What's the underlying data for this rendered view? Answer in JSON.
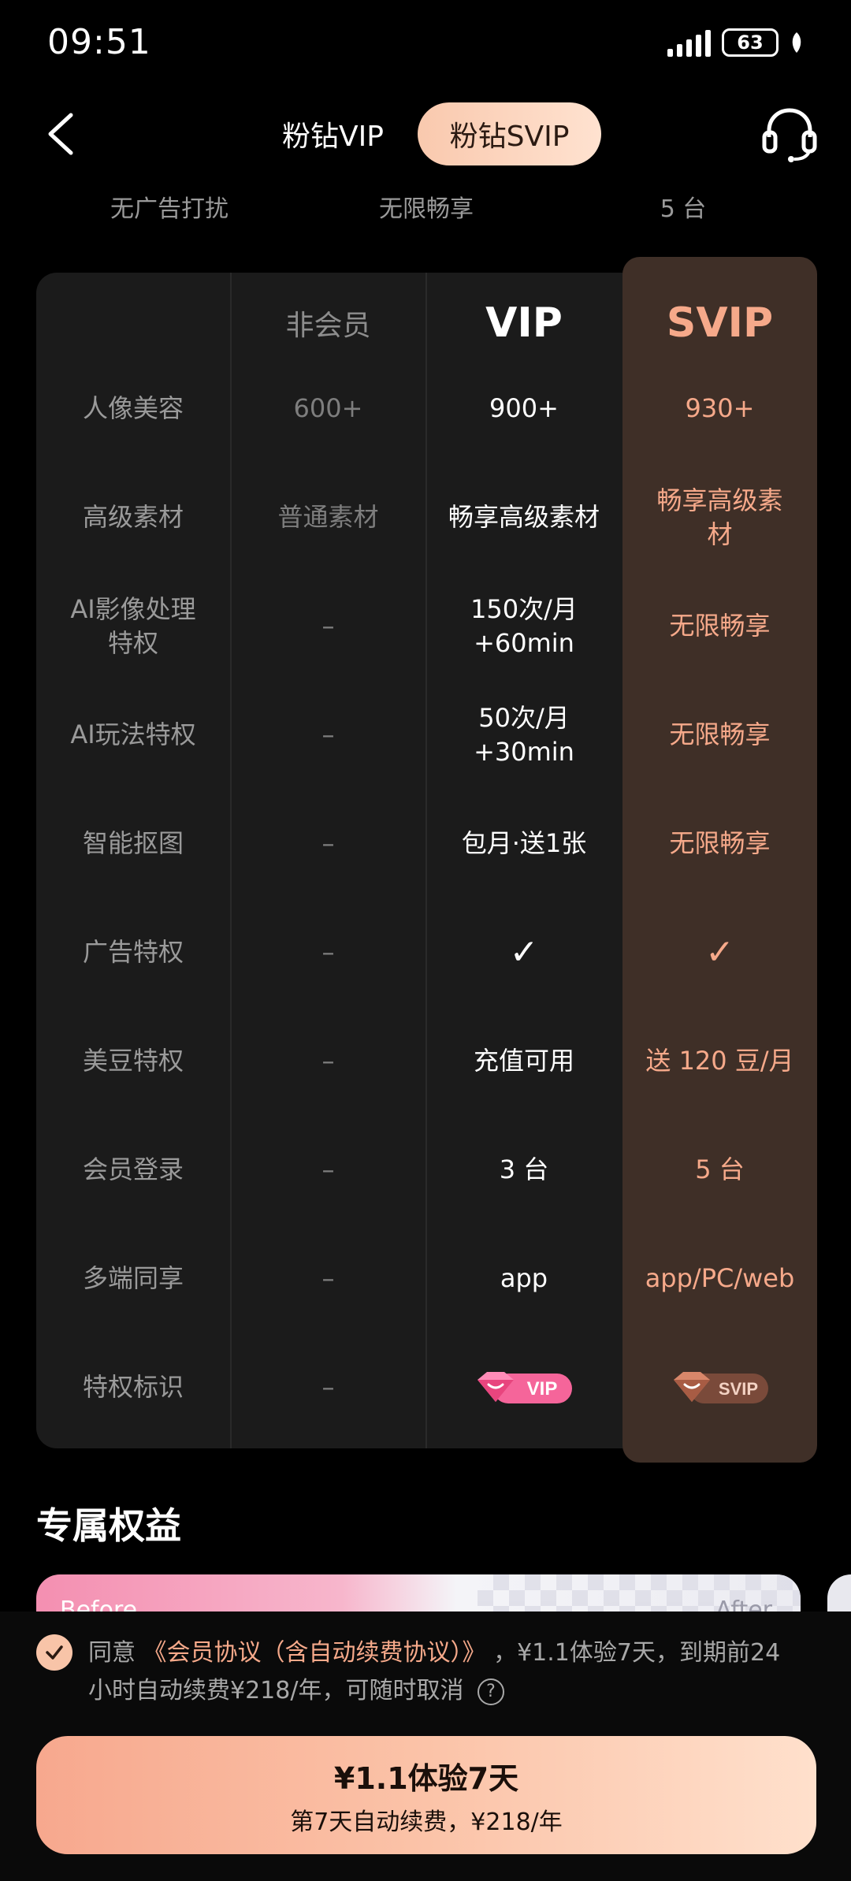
{
  "status_bar": {
    "time": "09:51",
    "battery": "63"
  },
  "header": {
    "tabs": [
      {
        "label": "粉钻VIP"
      },
      {
        "label": "粉钻SVIP"
      }
    ]
  },
  "summary": [
    "无广告打扰",
    "无限畅享",
    "5 台"
  ],
  "table": {
    "headers": {
      "non_member": "非会员",
      "vip": "VIP",
      "svip": "SVIP"
    },
    "rows": [
      {
        "label": "人像美容",
        "non_member": "600+",
        "vip": "900+",
        "svip": "930+"
      },
      {
        "label": "高级素材",
        "non_member": "普通素材",
        "vip": "畅享高级素材",
        "svip": "畅享高级素材"
      },
      {
        "label": "AI影像处理特权",
        "non_member": "–",
        "vip": "150次/月 +60min",
        "svip": "无限畅享"
      },
      {
        "label": "AI玩法特权",
        "non_member": "–",
        "vip": "50次/月 +30min",
        "svip": "无限畅享"
      },
      {
        "label": "智能抠图",
        "non_member": "–",
        "vip": "包月·送1张",
        "svip": "无限畅享"
      },
      {
        "label": "广告特权",
        "non_member": "–",
        "vip": "✓",
        "svip": "✓"
      },
      {
        "label": "美豆特权",
        "non_member": "–",
        "vip": "充值可用",
        "svip": "送 120 豆/月"
      },
      {
        "label": "会员登录",
        "non_member": "–",
        "vip": "3 台",
        "svip": "5 台"
      },
      {
        "label": "多端同享",
        "non_member": "–",
        "vip": "app",
        "svip": "app/PC/web"
      },
      {
        "label": "特权标识",
        "non_member": "–",
        "vip_badge": "VIP",
        "svip_badge": "SVIP"
      }
    ]
  },
  "section": {
    "title": "专属权益"
  },
  "banner": {
    "before": "Before",
    "after": "After"
  },
  "agreement": {
    "prefix": "同意",
    "link": "《会员协议（含自动续费协议）》",
    "suffix": "，¥1.1体验7天，到期前24小时自动续费¥218/年，可随时取消"
  },
  "cta": {
    "main": "¥1.1体验7天",
    "sub": "第7天自动续费，¥218/年"
  },
  "colors": {
    "accent": "#f6a98a",
    "svip_bg": "#3f2f27",
    "table_bg": "#1b1b1b"
  }
}
